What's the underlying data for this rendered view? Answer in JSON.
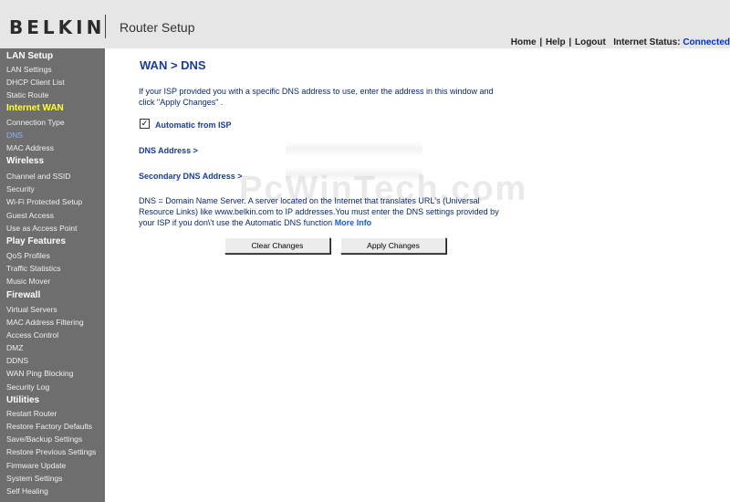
{
  "header": {
    "logo": "BELKIN",
    "title": "Router Setup",
    "links": [
      "Home",
      "Help",
      "Logout"
    ],
    "status_label": "Internet Status:",
    "status_value": "Connected"
  },
  "sidebar": {
    "sections": [
      {
        "title": "LAN Setup",
        "items": [
          "LAN Settings",
          "DHCP Client List",
          "Static Route"
        ]
      },
      {
        "title": "Internet WAN",
        "items": [
          "Connection Type",
          "DNS",
          "MAC Address"
        ]
      },
      {
        "title": "Wireless",
        "items": [
          "Channel and SSID",
          "Security",
          "Wi-Fi Protected Setup",
          "Guest Access",
          "Use as Access Point"
        ]
      },
      {
        "title": "Play Features",
        "items": [
          "QoS Profiles",
          "Traffic Statistics",
          "Music Mover"
        ]
      },
      {
        "title": "Firewall",
        "items": [
          "Virtual Servers",
          "MAC Address Filtering",
          "Access Control",
          "DMZ",
          "DDNS",
          "WAN Ping Blocking",
          "Security Log"
        ]
      },
      {
        "title": "Utilities",
        "items": [
          "Restart Router",
          "Restore Factory Defaults",
          "Save/Backup Settings",
          "Restore Previous Settings",
          "Firmware Update",
          "System Settings",
          "Self Healing"
        ]
      }
    ]
  },
  "main": {
    "title": "WAN > DNS",
    "intro_line1": "If your ISP provided you with a specific DNS address to use, enter the address in this window and",
    "intro_line2": "click \"Apply Changes\" .",
    "auto_checkbox": {
      "label": "Automatic from ISP",
      "checked": true
    },
    "dns_label": "DNS Address >",
    "secondary_dns_label": "Secondary DNS Address >",
    "desc_line1": "DNS = Domain Name Server. A server located on the Internet that translates URL's (Universal",
    "desc_line2": "Resource Links) like www.belkin.com to IP addresses.You must enter the DNS settings provided by",
    "desc_line3": "your ISP if you don\\'t use the Automatic DNS function",
    "more_info": "More Info",
    "clear_button": "Clear Changes",
    "apply_button": "Apply Changes"
  },
  "watermark": "PcWinTech.com"
}
